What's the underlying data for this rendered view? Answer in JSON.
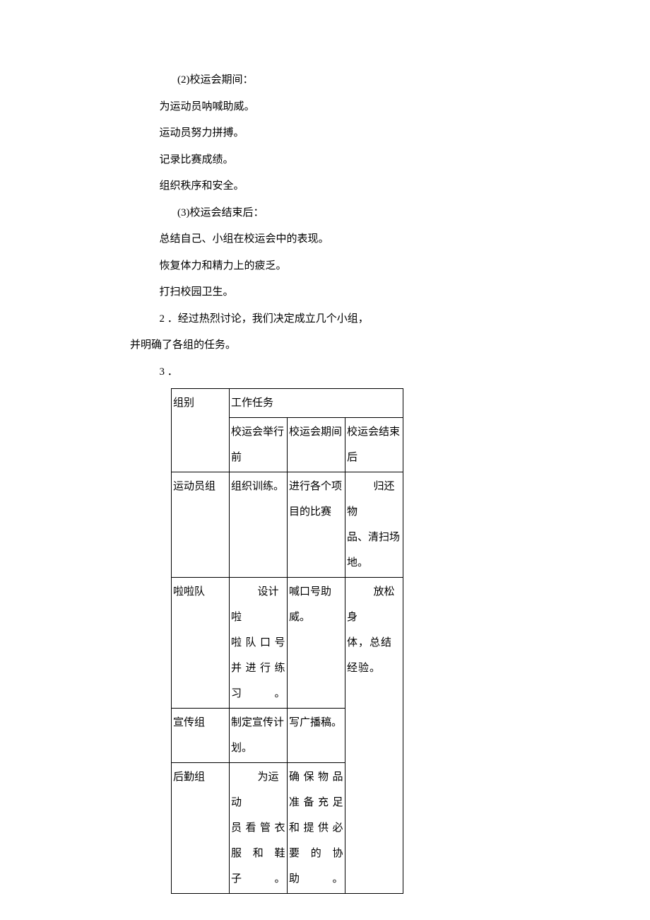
{
  "lines": {
    "l1": "(2)校运会期间：",
    "l2": "为运动员呐喊助威。",
    "l3": "运动员努力拼搏。",
    "l4": "记录比赛成绩。",
    "l5": "组织秩序和安全。",
    "l6": "(3)校运会结束后：",
    "l7": "总结自己、小组在校运会中的表现。",
    "l8": "恢复体力和精力上的疲乏。",
    "l9": "打扫校园卫生。",
    "l10a": "2 ．经过热烈讨论，我们决定成立几个小组，",
    "l10b": "并明确了各组的任务。",
    "l11": "3 ．"
  },
  "table": {
    "h_group": "组别",
    "h_task": "工作任务",
    "sub_before": "校运会举行前",
    "sub_during": "校运会期间",
    "sub_after": "校运会结束后",
    "rows": {
      "athlete": {
        "name": "运动员组",
        "before": "组织训练。",
        "during": "进行各个项目的比赛",
        "after_indent": "归还物",
        "after_rest": "品、清扫场地。"
      },
      "cheer": {
        "name": "啦啦队",
        "before_indent": "设计啦",
        "before_rest": "啦队口号并进行练习。",
        "during": "喊口号助威。",
        "after_indent": "放松身",
        "after_rest": "体，总结经验。"
      },
      "promo": {
        "name": "宣传组",
        "before": "制定宣传计划。",
        "during": "写广播稿。"
      },
      "logistics": {
        "name": "后勤组",
        "before_indent": "为运动",
        "before_rest": "员看管衣服和鞋子。",
        "during": "确保物品准备充足和提供必要的协助。"
      }
    }
  }
}
